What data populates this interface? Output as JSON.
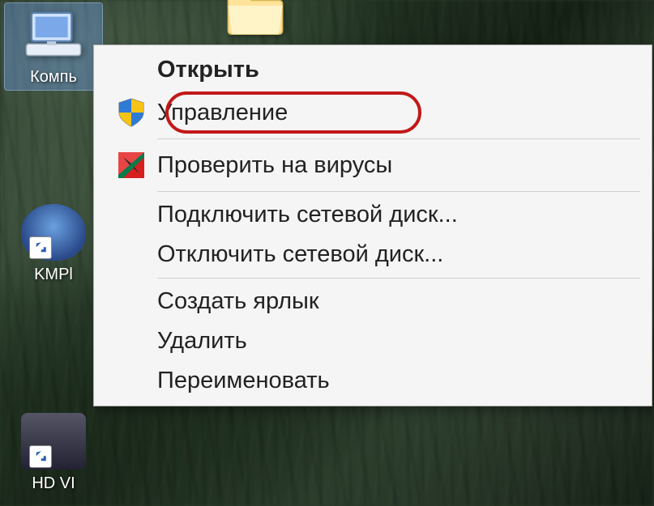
{
  "desktop": {
    "icons": {
      "computer": {
        "label": "Компь"
      },
      "folder": {
        "label": ""
      },
      "kmp": {
        "label": "KMPl"
      },
      "hd": {
        "label": "HD VI"
      }
    }
  },
  "context_menu": {
    "items": [
      {
        "id": "open",
        "label": "Открыть",
        "bold": true,
        "icon": null
      },
      {
        "id": "manage",
        "label": "Управление",
        "icon": "shield",
        "highlighted": true
      },
      {
        "id": "divider1",
        "divider": true
      },
      {
        "id": "scan",
        "label": "Проверить на вирусы",
        "icon": "kav"
      },
      {
        "id": "divider2",
        "divider": true
      },
      {
        "id": "map_drive",
        "label": "Подключить сетевой диск..."
      },
      {
        "id": "unmap_drive",
        "label": "Отключить сетевой диск..."
      },
      {
        "id": "divider3",
        "divider": true
      },
      {
        "id": "shortcut",
        "label": "Создать ярлык"
      },
      {
        "id": "delete",
        "label": "Удалить"
      },
      {
        "id": "rename",
        "label": "Переименовать"
      }
    ]
  }
}
